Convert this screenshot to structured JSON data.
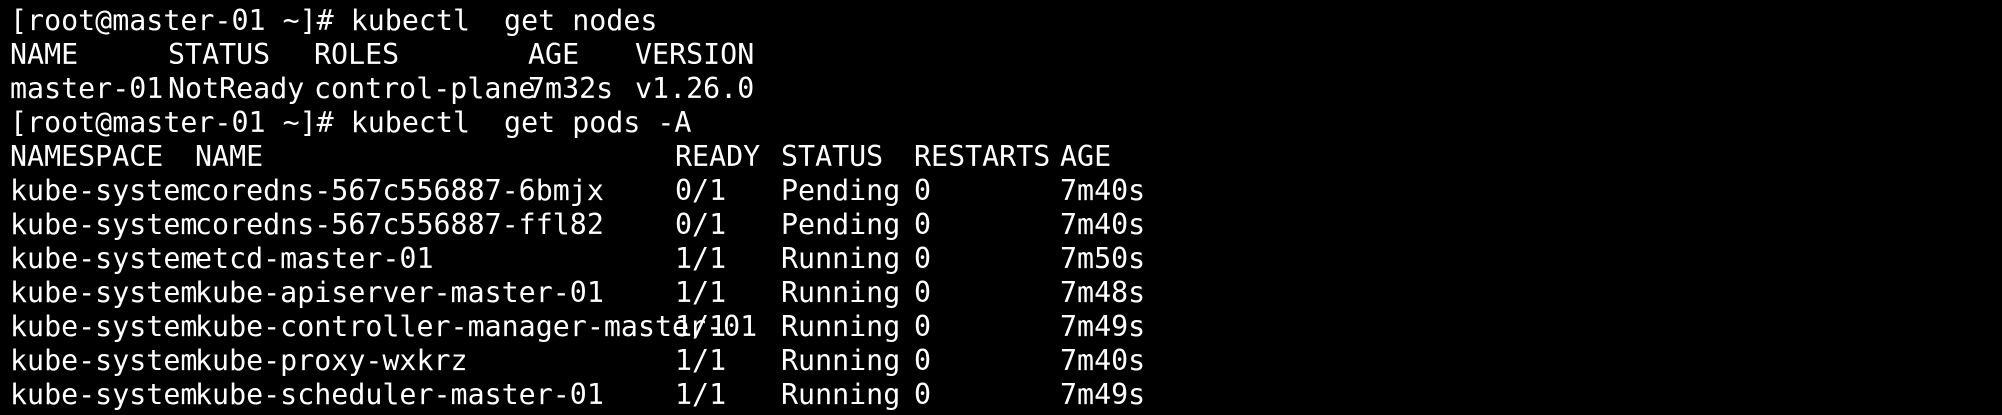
{
  "terminal": {
    "prompt": "[root@master-01 ~]# ",
    "commands": {
      "nodes": "kubectl  get nodes",
      "pods": "kubectl  get pods -A"
    },
    "nodes_table": {
      "headers": [
        "NAME",
        "STATUS",
        "ROLES",
        "AGE",
        "VERSION"
      ],
      "rows": [
        [
          "master-01",
          "NotReady",
          "control-plane",
          "7m32s",
          "v1.26.0"
        ]
      ]
    },
    "pods_table": {
      "headers": [
        "NAMESPACE",
        "NAME",
        "READY",
        "STATUS",
        "RESTARTS",
        "AGE"
      ],
      "rows": [
        [
          "kube-system",
          "coredns-567c556887-6bmjx",
          "0/1",
          "Pending",
          "0",
          "7m40s"
        ],
        [
          "kube-system",
          "coredns-567c556887-ffl82",
          "0/1",
          "Pending",
          "0",
          "7m40s"
        ],
        [
          "kube-system",
          "etcd-master-01",
          "1/1",
          "Running",
          "0",
          "7m50s"
        ],
        [
          "kube-system",
          "kube-apiserver-master-01",
          "1/1",
          "Running",
          "0",
          "7m48s"
        ],
        [
          "kube-system",
          "kube-controller-manager-master-01",
          "1/1",
          "Running",
          "0",
          "7m49s"
        ],
        [
          "kube-system",
          "kube-proxy-wxkrz",
          "1/1",
          "Running",
          "0",
          "7m40s"
        ],
        [
          "kube-system",
          "kube-scheduler-master-01",
          "1/1",
          "Running",
          "0",
          "7m49s"
        ]
      ]
    },
    "colors": {
      "background": "#000000",
      "foreground": "#ffffff"
    }
  }
}
